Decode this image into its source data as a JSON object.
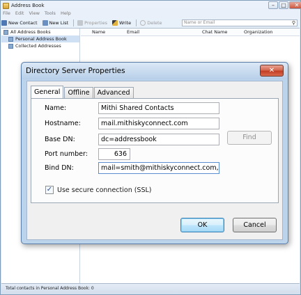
{
  "app": {
    "title": "Address Book",
    "window_controls": {
      "minimize": "–",
      "maximize": "□",
      "close": "✕"
    }
  },
  "menubar": [
    "File",
    "Edit",
    "View",
    "Tools",
    "Help"
  ],
  "toolbar": {
    "new_contact": "New Contact",
    "new_list": "New List",
    "properties": "Properties",
    "write": "Write",
    "delete": "Delete",
    "search_placeholder": "Name or Email"
  },
  "tree": {
    "root": "All Address Books",
    "children": [
      "Personal Address Book",
      "Collected Addresses"
    ]
  },
  "list_columns": [
    "Name",
    "Email",
    "Chat Name",
    "Organization"
  ],
  "status": "Total contacts in Personal Address Book: 0",
  "dialog": {
    "title": "Directory Server Properties",
    "close": "✕",
    "tabs": [
      "General",
      "Offline",
      "Advanced"
    ],
    "fields": {
      "name_label": "Name:",
      "name_value": "Mithi Shared Contacts",
      "hostname_label": "Hostname:",
      "hostname_value": "mail.mithiskyconnect.com",
      "basedn_label": "Base DN:",
      "basedn_value": "dc=addressbook",
      "port_label": "Port number:",
      "port_value": "636",
      "binddn_label": "Bind DN:",
      "binddn_value": "mail=smith@mithiskyconnect.com,dc"
    },
    "find_button": "Find",
    "ssl_label": "Use secure connection (SSL)",
    "ssl_checked": true,
    "ok_button": "OK",
    "cancel_button": "Cancel"
  },
  "colors": {
    "dialog_frame": "#bcd3ec",
    "close_red": "#c23e24",
    "selection": "#cfe0f5"
  }
}
